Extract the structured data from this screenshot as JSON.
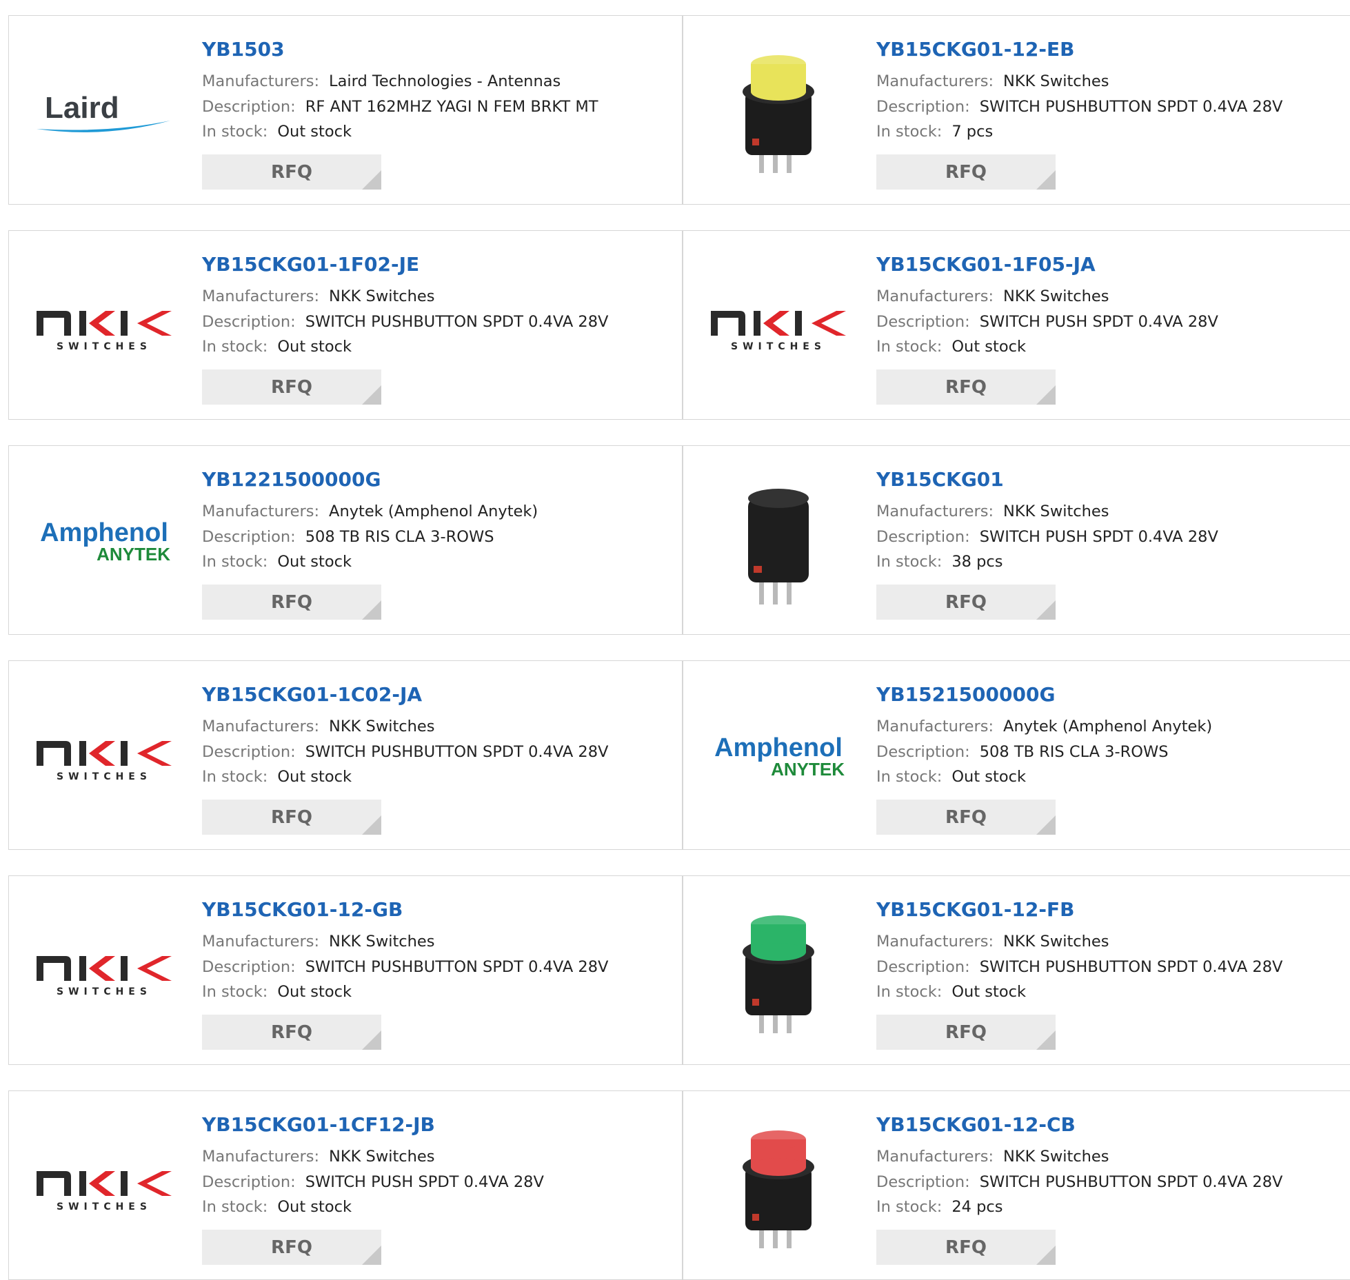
{
  "labels": {
    "manufacturers": "Manufacturers:",
    "description": "Description:",
    "stock": "In stock:",
    "rfq": "RFQ"
  },
  "colors": {
    "title": "#1e64b4",
    "label": "#777777",
    "value": "#222222",
    "border": "#d6d6d6",
    "button_bg": "#ececec",
    "button_text": "#666666"
  },
  "products": [
    {
      "part": "YB1503",
      "manufacturer": "Laird Technologies - Antennas",
      "description": "RF ANT 162MHZ YAGI N FEM BRKT MT",
      "stock": "Out stock",
      "image": "laird-logo",
      "logo_text": "Laird"
    },
    {
      "part": "YB15CKG01-12-EB",
      "manufacturer": "NKK Switches",
      "description": "SWITCH PUSHBUTTON SPDT 0.4VA 28V",
      "stock": "7 pcs",
      "image": "yellow-pushbutton-photo"
    },
    {
      "part": "YB15CKG01-1F02-JE",
      "manufacturer": "NKK Switches",
      "description": "SWITCH PUSHBUTTON SPDT 0.4VA 28V",
      "stock": "Out stock",
      "image": "nkk-logo",
      "logo_text": "SWITCHES"
    },
    {
      "part": "YB15CKG01-1F05-JA",
      "manufacturer": "NKK Switches",
      "description": "SWITCH PUSH SPDT 0.4VA 28V",
      "stock": "Out stock",
      "image": "nkk-logo",
      "logo_text": "SWITCHES"
    },
    {
      "part": "YB1221500000G",
      "manufacturer": "Anytek (Amphenol Anytek)",
      "description": "508 TB RIS CLA 3-ROWS",
      "stock": "Out stock",
      "image": "amphenol-logo",
      "logo_text": "Amphenol",
      "logo_subtext": "ANYTEK"
    },
    {
      "part": "YB15CKG01",
      "manufacturer": "NKK Switches",
      "description": "SWITCH PUSH SPDT 0.4VA 28V",
      "stock": "38 pcs",
      "image": "black-pushbutton-photo"
    },
    {
      "part": "YB15CKG01-1C02-JA",
      "manufacturer": "NKK Switches",
      "description": "SWITCH PUSHBUTTON SPDT 0.4VA 28V",
      "stock": "Out stock",
      "image": "nkk-logo",
      "logo_text": "SWITCHES"
    },
    {
      "part": "YB1521500000G",
      "manufacturer": "Anytek (Amphenol Anytek)",
      "description": "508 TB RIS CLA 3-ROWS",
      "stock": "Out stock",
      "image": "amphenol-logo",
      "logo_text": "Amphenol",
      "logo_subtext": "ANYTEK"
    },
    {
      "part": "YB15CKG01-12-GB",
      "manufacturer": "NKK Switches",
      "description": "SWITCH PUSHBUTTON SPDT 0.4VA 28V",
      "stock": "Out stock",
      "image": "nkk-logo",
      "logo_text": "SWITCHES"
    },
    {
      "part": "YB15CKG01-12-FB",
      "manufacturer": "NKK Switches",
      "description": "SWITCH PUSHBUTTON SPDT 0.4VA 28V",
      "stock": "Out stock",
      "image": "green-pushbutton-photo"
    },
    {
      "part": "YB15CKG01-1CF12-JB",
      "manufacturer": "NKK Switches",
      "description": "SWITCH PUSH SPDT 0.4VA 28V",
      "stock": "Out stock",
      "image": "nkk-logo",
      "logo_text": "SWITCHES"
    },
    {
      "part": "YB15CKG01-12-CB",
      "manufacturer": "NKK Switches",
      "description": "SWITCH PUSHBUTTON SPDT 0.4VA 28V",
      "stock": "24 pcs",
      "image": "red-pushbutton-photo"
    }
  ]
}
